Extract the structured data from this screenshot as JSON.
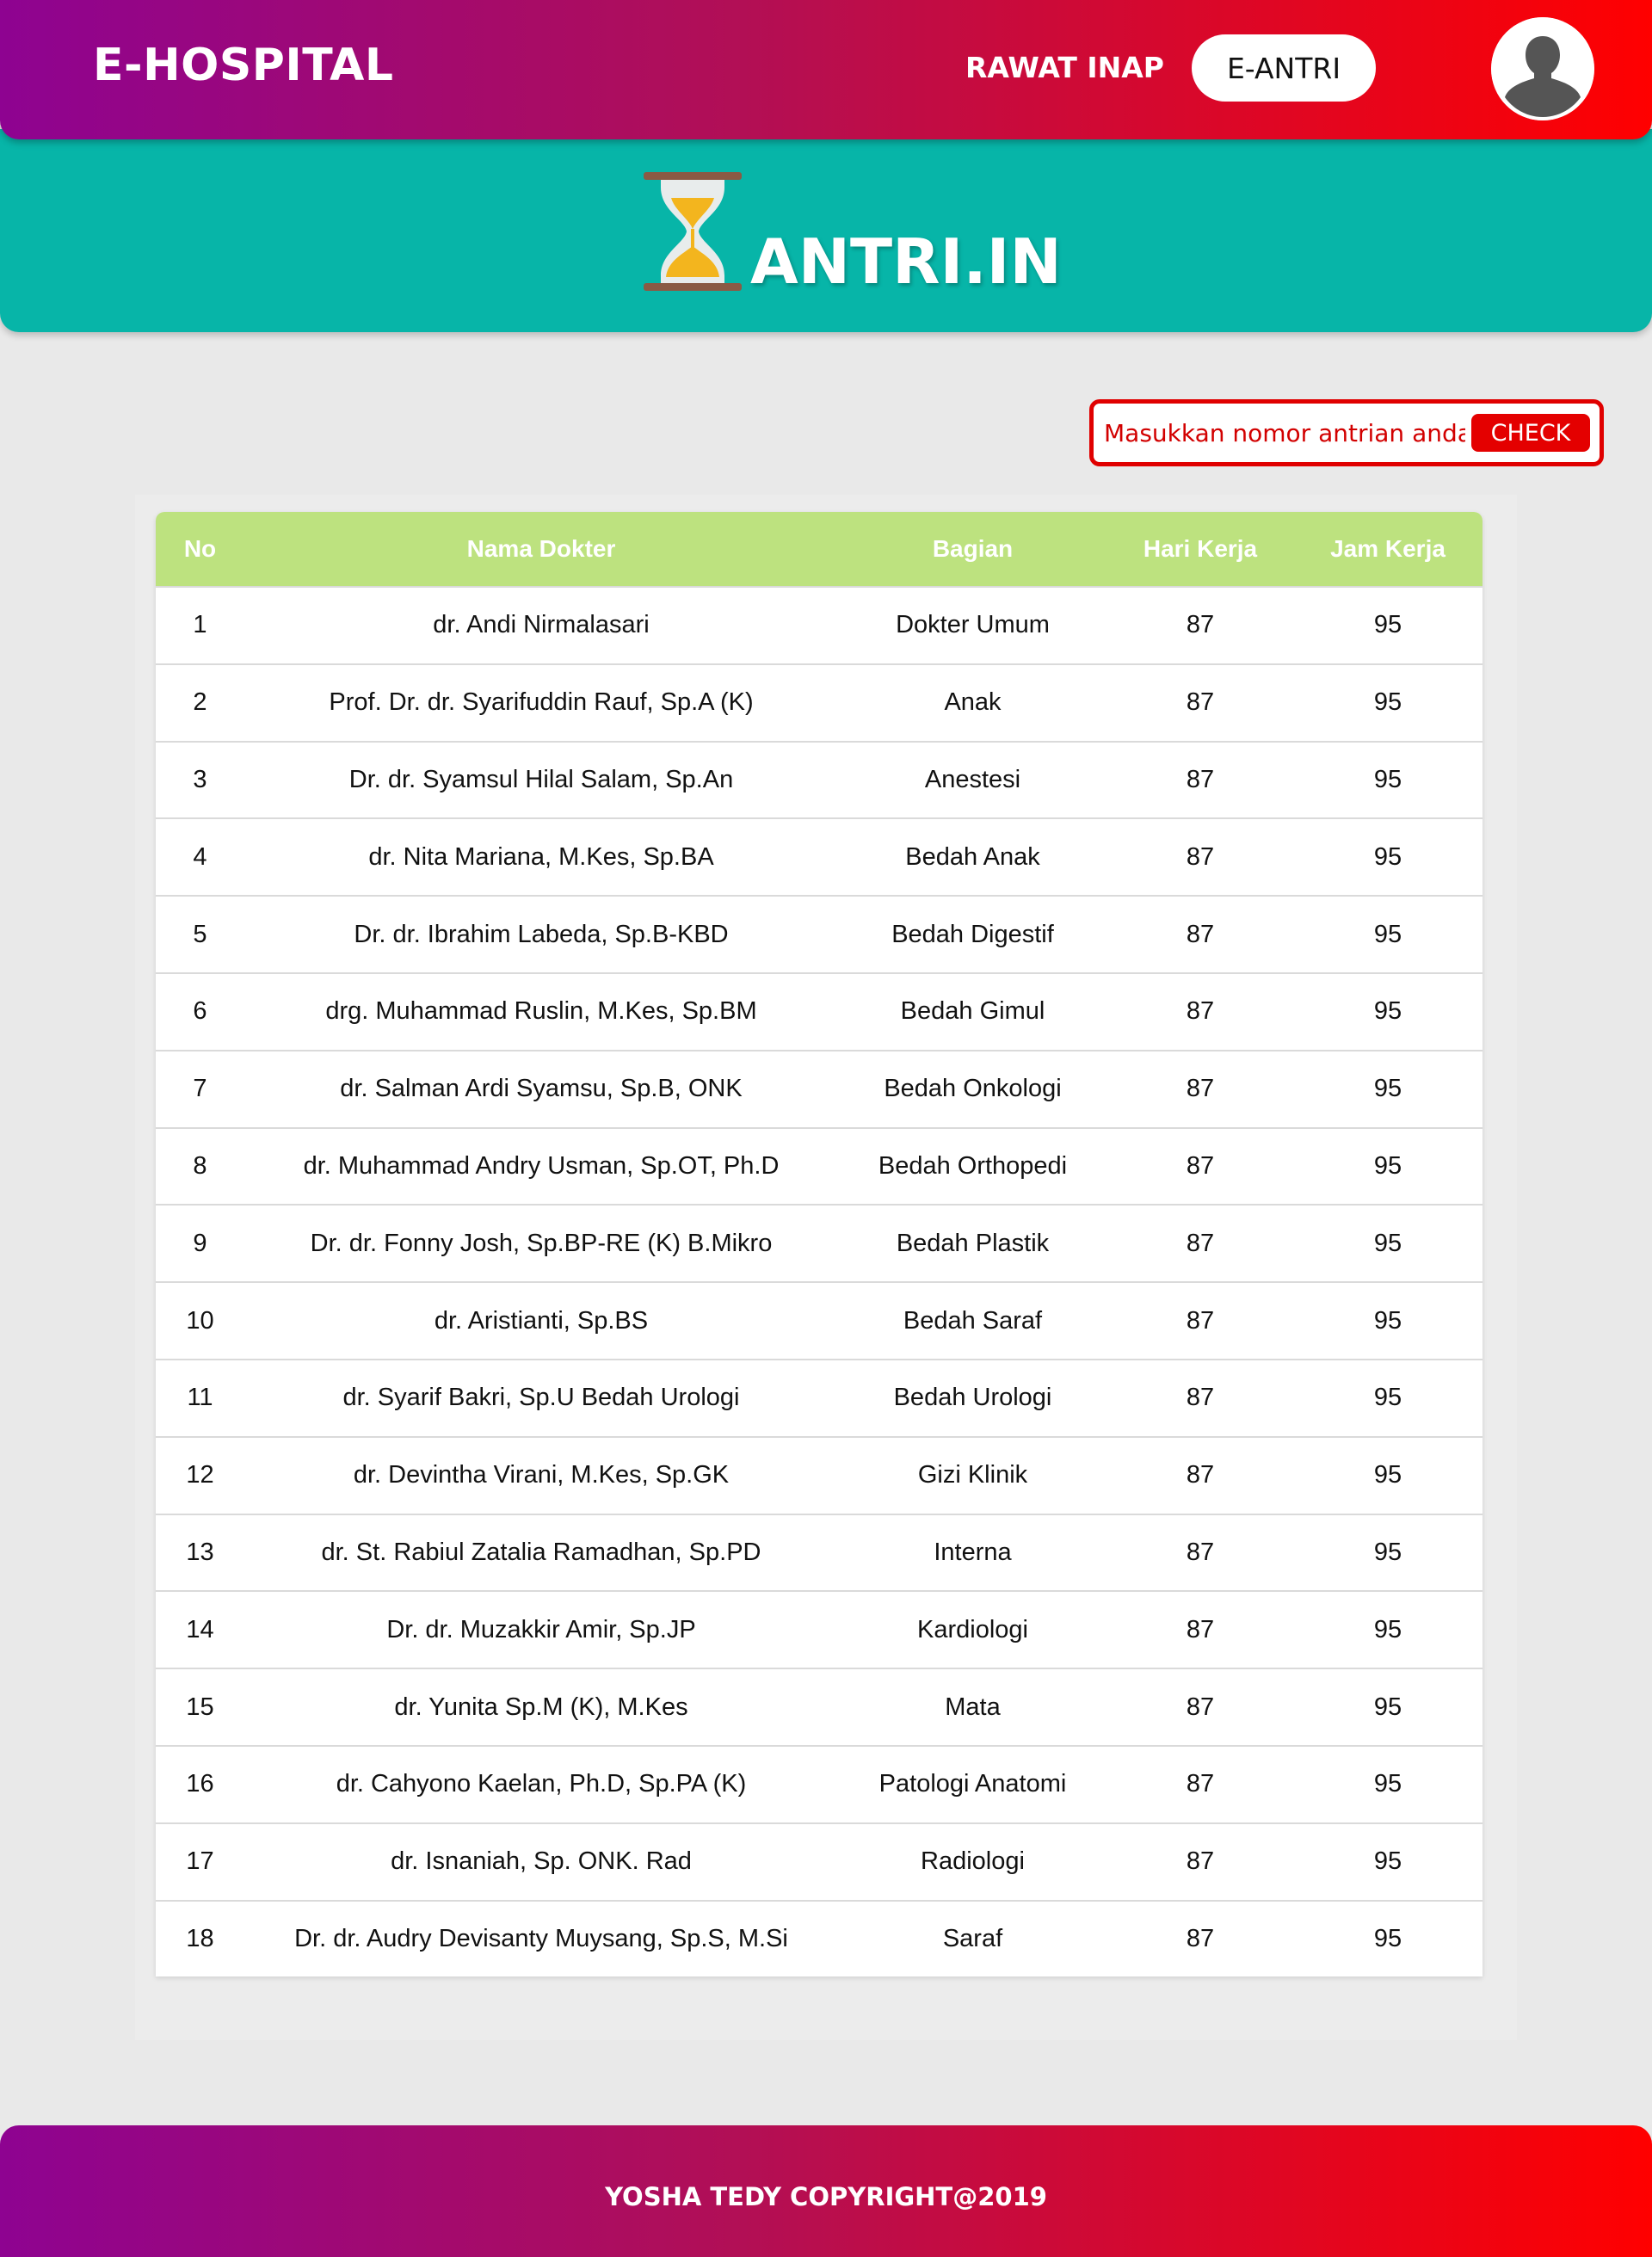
{
  "header": {
    "brand": "E-HOSPITAL",
    "nav": {
      "rawat_inap": "RAWAT INAP",
      "e_antri": "E-ANTRI"
    },
    "gradient_start": "#8e0391",
    "gradient_end": "#ff0000"
  },
  "banner": {
    "title": "ANTRI.IN",
    "background": "#07b5a8",
    "icon": "hourglass-icon"
  },
  "check": {
    "placeholder": "Masukkan nomor antrian anda",
    "button_label": "CHECK",
    "accent": "#e00000"
  },
  "table": {
    "header_color": "#bde27f",
    "columns": [
      "No",
      "Nama Dokter",
      "Bagian",
      "Hari Kerja",
      "Jam Kerja"
    ],
    "rows": [
      {
        "no": "1",
        "nama": "dr. Andi Nirmalasari",
        "bagian": "Dokter Umum",
        "hari": "87",
        "jam": "95"
      },
      {
        "no": "2",
        "nama": "Prof. Dr. dr. Syarifuddin Rauf, Sp.A (K)",
        "bagian": "Anak",
        "hari": "87",
        "jam": "95"
      },
      {
        "no": "3",
        "nama": "Dr. dr. Syamsul Hilal Salam, Sp.An",
        "bagian": "Anestesi",
        "hari": "87",
        "jam": "95"
      },
      {
        "no": "4",
        "nama": "dr. Nita Mariana, M.Kes, Sp.BA",
        "bagian": "Bedah Anak",
        "hari": "87",
        "jam": "95"
      },
      {
        "no": "5",
        "nama": "Dr. dr. Ibrahim Labeda, Sp.B-KBD",
        "bagian": "Bedah Digestif",
        "hari": "87",
        "jam": "95"
      },
      {
        "no": "6",
        "nama": "drg. Muhammad Ruslin, M.Kes, Sp.BM",
        "bagian": "Bedah Gimul",
        "hari": "87",
        "jam": "95"
      },
      {
        "no": "7",
        "nama": "dr. Salman Ardi Syamsu, Sp.B, ONK",
        "bagian": "Bedah Onkologi",
        "hari": "87",
        "jam": "95"
      },
      {
        "no": "8",
        "nama": "dr. Muhammad Andry Usman, Sp.OT, Ph.D",
        "bagian": "Bedah Orthopedi",
        "hari": "87",
        "jam": "95"
      },
      {
        "no": "9",
        "nama": "Dr. dr. Fonny Josh, Sp.BP-RE (K) B.Mikro",
        "bagian": "Bedah Plastik",
        "hari": "87",
        "jam": "95"
      },
      {
        "no": "10",
        "nama": "dr. Aristianti, Sp.BS",
        "bagian": "Bedah Saraf",
        "hari": "87",
        "jam": "95"
      },
      {
        "no": "11",
        "nama": "dr. Syarif Bakri, Sp.U Bedah Urologi",
        "bagian": "Bedah Urologi",
        "hari": "87",
        "jam": "95"
      },
      {
        "no": "12",
        "nama": "dr. Devintha Virani, M.Kes, Sp.GK",
        "bagian": "Gizi Klinik",
        "hari": "87",
        "jam": "95"
      },
      {
        "no": "13",
        "nama": "dr. St. Rabiul Zatalia Ramadhan, Sp.PD",
        "bagian": "Interna",
        "hari": "87",
        "jam": "95"
      },
      {
        "no": "14",
        "nama": "Dr. dr. Muzakkir Amir, Sp.JP",
        "bagian": "Kardiologi",
        "hari": "87",
        "jam": "95"
      },
      {
        "no": "15",
        "nama": "dr. Yunita Sp.M (K), M.Kes",
        "bagian": "Mata",
        "hari": "87",
        "jam": "95"
      },
      {
        "no": "16",
        "nama": "dr. Cahyono Kaelan, Ph.D, Sp.PA (K)",
        "bagian": "Patologi Anatomi",
        "hari": "87",
        "jam": "95"
      },
      {
        "no": "17",
        "nama": "dr. Isnaniah, Sp. ONK. Rad",
        "bagian": "Radiologi",
        "hari": "87",
        "jam": "95"
      },
      {
        "no": "18",
        "nama": "Dr. dr. Audry Devisanty Muysang, Sp.S, M.Si",
        "bagian": "Saraf",
        "hari": "87",
        "jam": "95"
      }
    ]
  },
  "footer": {
    "copyright": "YOSHA TEDY COPYRIGHT@2019"
  }
}
